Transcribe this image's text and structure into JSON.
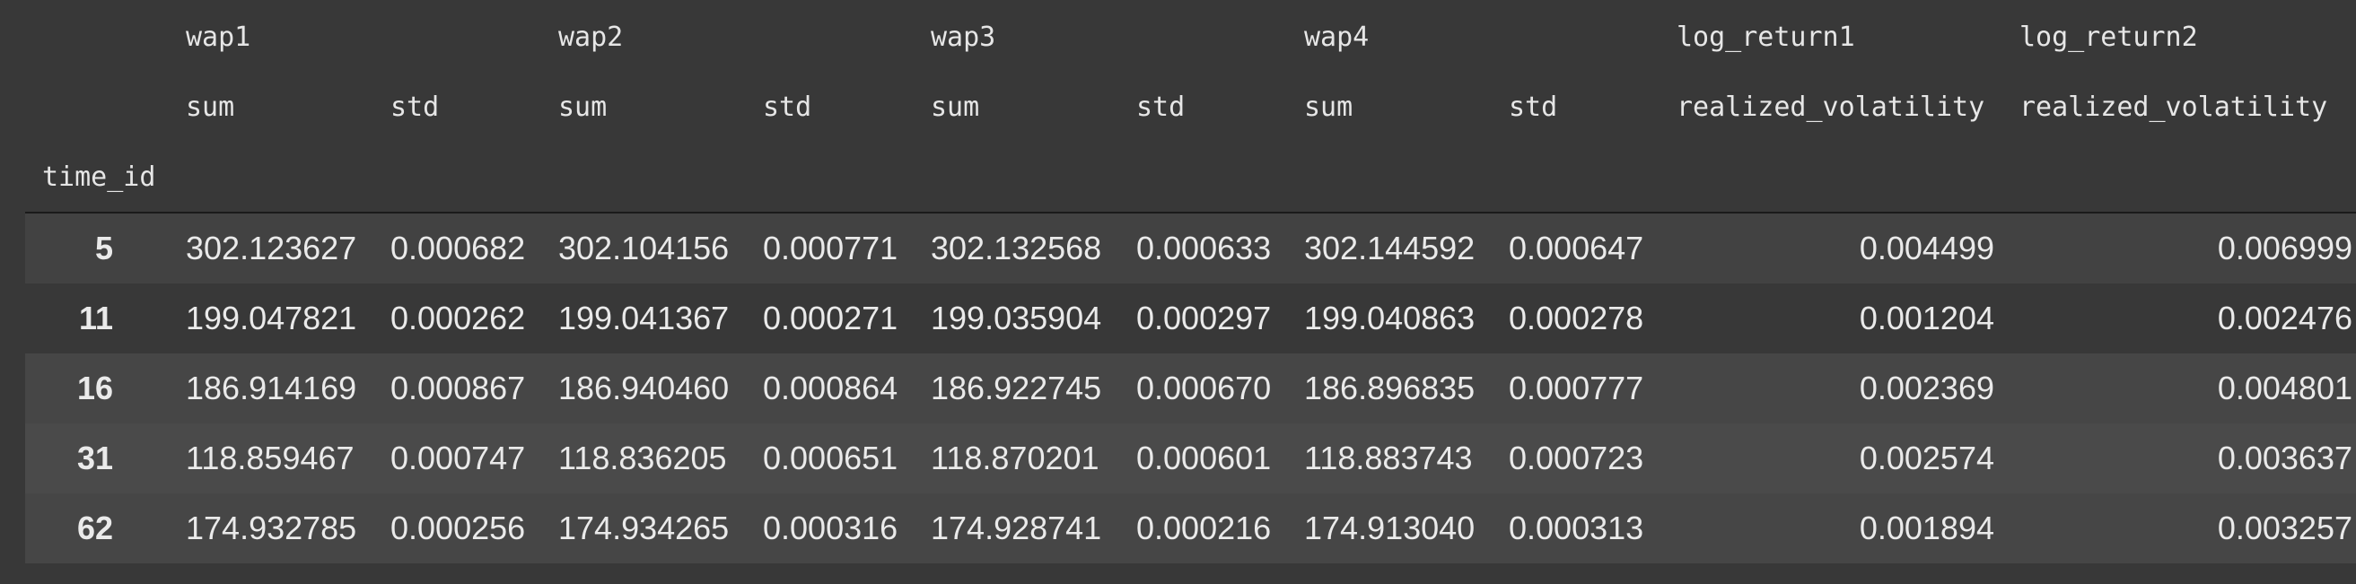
{
  "table": {
    "columns_level0": [
      "wap1",
      "wap2",
      "wap3",
      "wap4",
      "log_return1",
      "log_return2"
    ],
    "columns_level1": [
      "sum",
      "std",
      "sum",
      "std",
      "sum",
      "std",
      "sum",
      "std",
      "realized_volatility",
      "realized_volatility"
    ],
    "index_name": "time_id",
    "rows": [
      {
        "index": "5",
        "cells": [
          "302.123627",
          "0.000682",
          "302.104156",
          "0.000771",
          "302.132568",
          "0.000633",
          "302.144592",
          "0.000647",
          "0.004499",
          "0.006999"
        ]
      },
      {
        "index": "11",
        "cells": [
          "199.047821",
          "0.000262",
          "199.041367",
          "0.000271",
          "199.035904",
          "0.000297",
          "199.040863",
          "0.000278",
          "0.001204",
          "0.002476"
        ]
      },
      {
        "index": "16",
        "cells": [
          "186.914169",
          "0.000867",
          "186.940460",
          "0.000864",
          "186.922745",
          "0.000670",
          "186.896835",
          "0.000777",
          "0.002369",
          "0.004801"
        ]
      },
      {
        "index": "31",
        "cells": [
          "118.859467",
          "0.000747",
          "118.836205",
          "0.000651",
          "118.870201",
          "0.000601",
          "118.883743",
          "0.000723",
          "0.002574",
          "0.003637"
        ]
      },
      {
        "index": "62",
        "cells": [
          "174.932785",
          "0.000256",
          "174.934265",
          "0.000316",
          "174.928741",
          "0.000216",
          "174.913040",
          "0.000313",
          "0.001894",
          "0.003257"
        ]
      }
    ]
  }
}
